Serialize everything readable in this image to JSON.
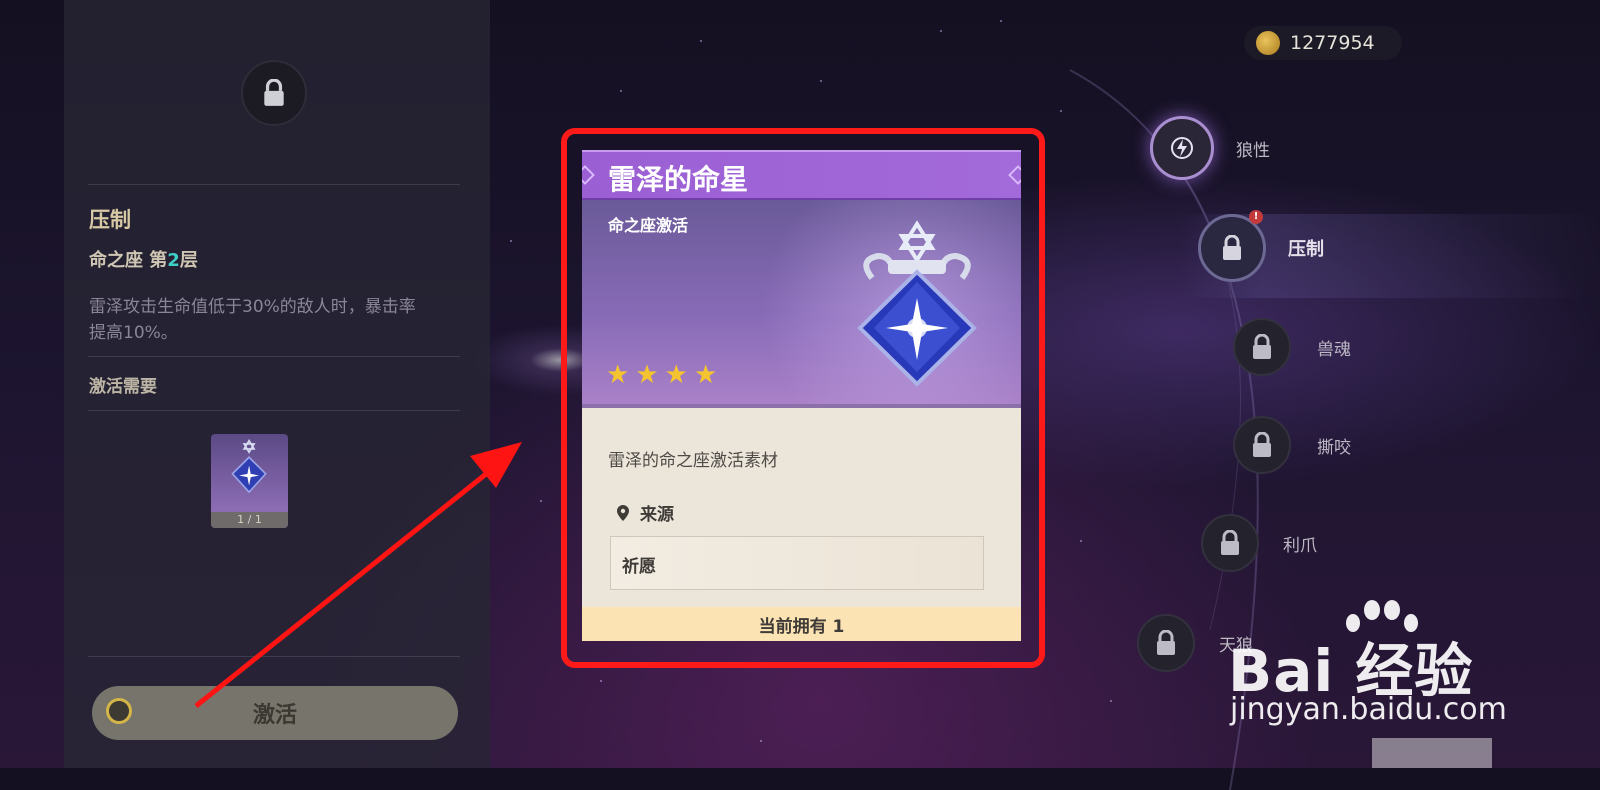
{
  "currency": {
    "icon": "mora-coin-icon",
    "amount": "1277954"
  },
  "left_panel": {
    "title": "压制",
    "constellation_prefix": "命之座 第",
    "constellation_level": "2",
    "constellation_suffix": "层",
    "description": "雷泽攻击生命值低于30%的敌人时，暴击率提高10%。",
    "requirement_label": "激活需要",
    "material_count": "1 / 1",
    "activate_button": "激活"
  },
  "constellations": [
    {
      "name": "狼性",
      "state": "unlocked",
      "icon": "electro-icon"
    },
    {
      "name": "压制",
      "state": "selected",
      "icon": "lock-icon",
      "alert": "!"
    },
    {
      "name": "兽魂",
      "state": "locked",
      "icon": "lock-icon"
    },
    {
      "name": "撕咬",
      "state": "locked",
      "icon": "lock-icon"
    },
    {
      "name": "利爪",
      "state": "locked",
      "icon": "lock-icon"
    },
    {
      "name": "天狼",
      "state": "locked",
      "icon": "lock-icon"
    }
  ],
  "item_card": {
    "title": "雷泽的命星",
    "category": "命之座激活",
    "rarity": 4,
    "rarity_symbol": "★",
    "description": "雷泽的命之座激活素材",
    "source_label": "来源",
    "source_item": "祈愿",
    "owned_text": "当前拥有 1"
  },
  "watermark": {
    "brand": "Bai  经验",
    "url": "jingyan.baidu.com"
  },
  "colors": {
    "highlight_frame": "#ff1a1a",
    "card_header": "#9b5fd4",
    "level_accent": "#3ed0c8"
  }
}
